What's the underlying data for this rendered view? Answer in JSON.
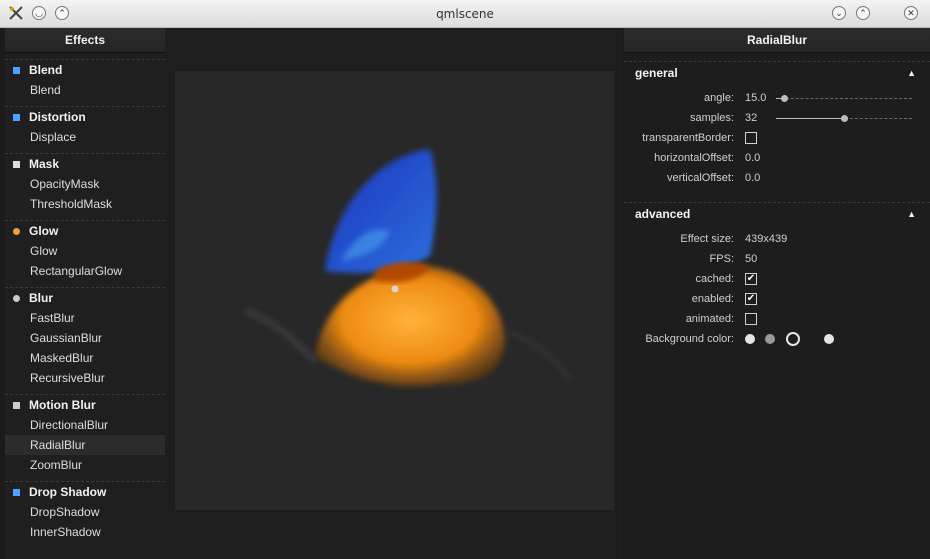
{
  "window": {
    "title": "qmlscene"
  },
  "sidebar": {
    "header": "Effects",
    "categories": [
      {
        "title": "Blend",
        "icon": "blend-icon",
        "items": [
          "Blend"
        ]
      },
      {
        "title": "Distortion",
        "icon": "distortion-icon",
        "items": [
          "Displace"
        ]
      },
      {
        "title": "Mask",
        "icon": "mask-icon",
        "items": [
          "OpacityMask",
          "ThresholdMask"
        ]
      },
      {
        "title": "Glow",
        "icon": "glow-icon",
        "items": [
          "Glow",
          "RectangularGlow"
        ]
      },
      {
        "title": "Blur",
        "icon": "blur-icon",
        "items": [
          "FastBlur",
          "GaussianBlur",
          "MaskedBlur",
          "RecursiveBlur"
        ]
      },
      {
        "title": "Motion Blur",
        "icon": "motion-blur-icon",
        "items": [
          "DirectionalBlur",
          "RadialBlur",
          "ZoomBlur"
        ]
      },
      {
        "title": "Drop Shadow",
        "icon": "drop-shadow-icon",
        "items": [
          "DropShadow",
          "InnerShadow"
        ]
      }
    ],
    "selected": "RadialBlur"
  },
  "panel": {
    "header": "RadialBlur",
    "general": {
      "title": "general",
      "angle_label": "angle:",
      "angle_value": "15.0",
      "angle_level": 0.06,
      "samples_label": "samples:",
      "samples_value": "32",
      "samples_level": 0.5,
      "transparent_label": "transparentBorder:",
      "transparent_checked": false,
      "hoffset_label": "horizontalOffset:",
      "hoffset_value": "0.0",
      "voffset_label": "verticalOffset:",
      "voffset_value": "0.0"
    },
    "advanced": {
      "title": "advanced",
      "size_label": "Effect size:",
      "size_value": "439x439",
      "fps_label": "FPS:",
      "fps_value": "50",
      "cached_label": "cached:",
      "cached_checked": true,
      "enabled_label": "enabled:",
      "enabled_checked": true,
      "animated_label": "animated:",
      "animated_checked": false,
      "bg_label": "Background color:",
      "bg_colors": [
        "#e6e6e6",
        "#9a9a9a",
        "#1d1d1d",
        "#1d1d1d",
        "#e6e6e6"
      ]
    }
  },
  "colors": {
    "accent_blue": "#2f7fd8",
    "orange": "#f08a14",
    "wing_blue": "#1a3fc0"
  }
}
